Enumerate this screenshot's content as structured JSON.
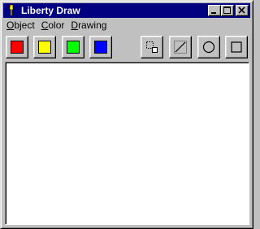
{
  "window": {
    "title": "Liberty Draw"
  },
  "title_buttons": {
    "minimize_icon": "minimize-icon",
    "maximize_icon": "maximize-icon",
    "close_icon": "close-icon"
  },
  "menu": {
    "items": [
      {
        "accel": "O",
        "rest": "bject"
      },
      {
        "accel": "C",
        "rest": "olor"
      },
      {
        "accel": "D",
        "rest": "rawing"
      }
    ]
  },
  "colors": {
    "red": "#ff0000",
    "yellow": "#ffff00",
    "green": "#00ff00",
    "blue": "#0000ff",
    "titlebar": "#000080"
  },
  "toolbar": {
    "color_buttons": [
      "red",
      "yellow",
      "green",
      "blue"
    ],
    "drawing_tools": [
      "select-icon",
      "line-icon",
      "circle-icon",
      "rectangle-icon"
    ]
  }
}
